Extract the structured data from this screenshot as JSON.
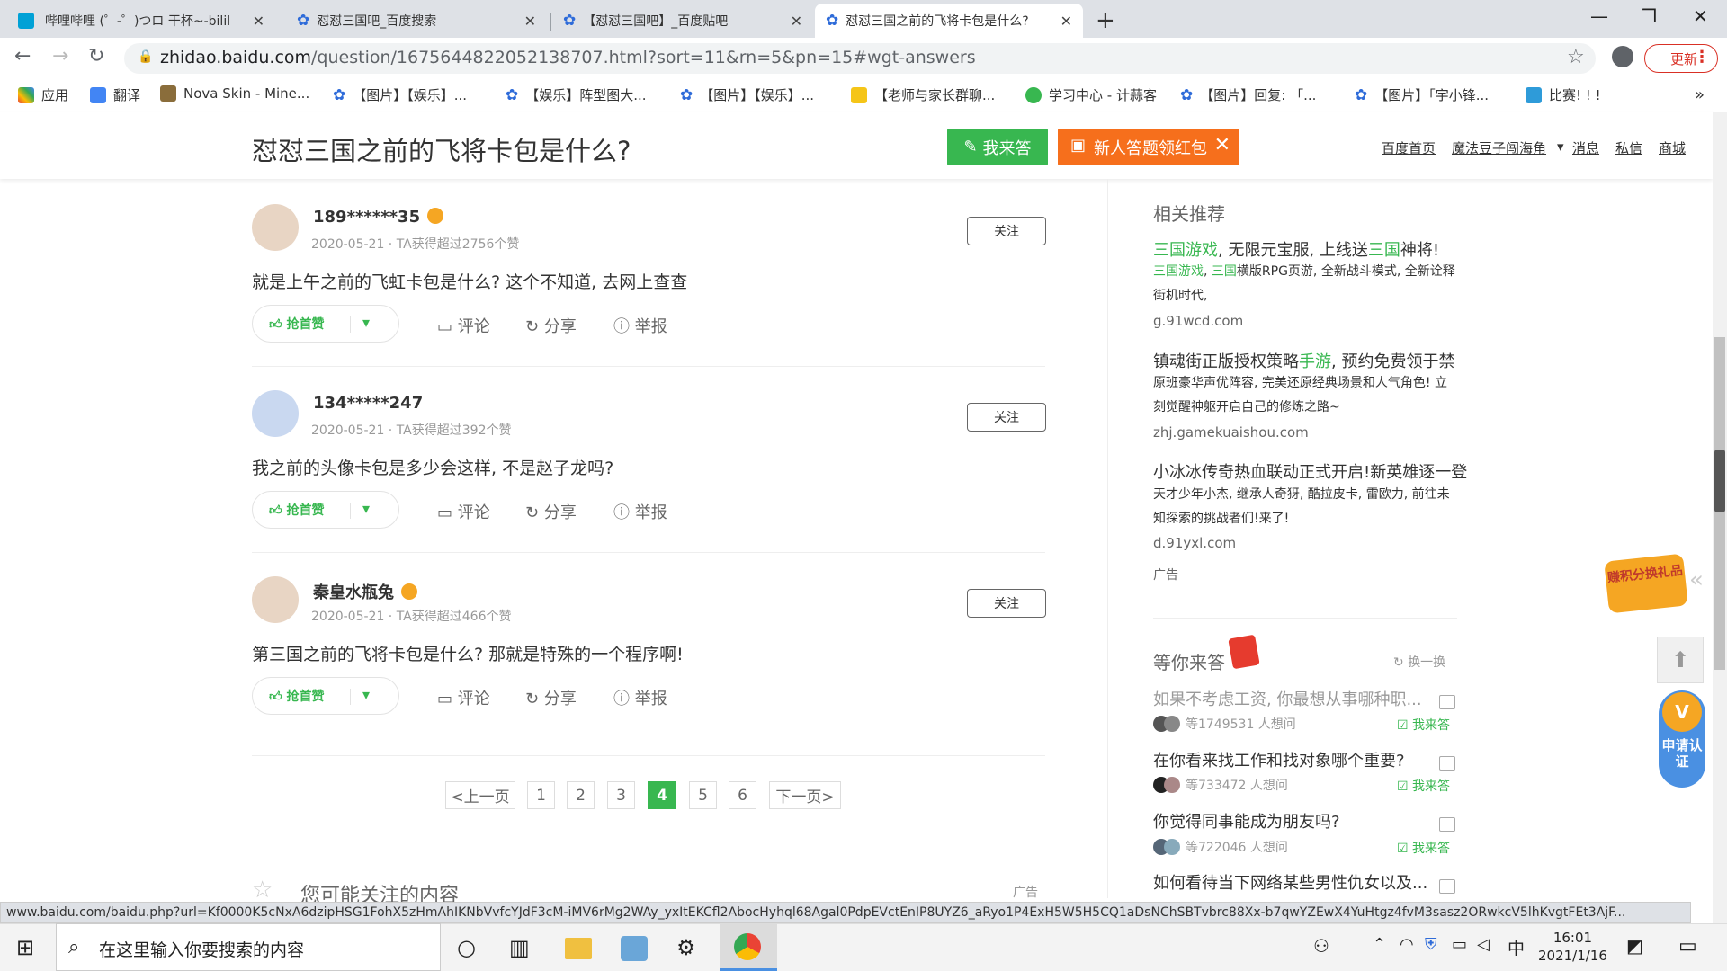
{
  "tabs": [
    {
      "title": "哔哩哔哩 (゜-゜)つロ 干杯~-bilil",
      "active": false
    },
    {
      "title": "怼怼三国吧_百度搜索",
      "active": false
    },
    {
      "title": "【怼怼三国吧】_百度贴吧",
      "active": false
    },
    {
      "title": "怼怼三国之前的飞将卡包是什么?",
      "active": true
    }
  ],
  "url": {
    "host": "zhidao.baidu.com",
    "path": "/question/1675644822052138707.html?sort=11&rn=5&pn=15#wgt-answers"
  },
  "update_label": "更新",
  "bookmarks": [
    "应用",
    "翻译",
    "Nova Skin - Mine...",
    "【图片】【娱乐】...",
    "【娱乐】阵型图大...",
    "【图片】【娱乐】...",
    "【老师与家长群聊...",
    "学习中心 - 计蒜客",
    "【图片】回复: 「...",
    "【图片】「宇小锋...",
    "比赛! ! !"
  ],
  "header": {
    "title": "怼怼三国之前的飞将卡包是什么?",
    "answer_btn": "我来答",
    "hongbao": "新人答题领红包",
    "nav": [
      "百度首页",
      "魔法豆子闯海角",
      "消息",
      "私信",
      "商城"
    ]
  },
  "answers": [
    {
      "user": "189******35",
      "meta": "2020-05-21 · TA获得超过2756个赞",
      "follow": "关注",
      "body": "就是上午之前的飞虹卡包是什么? 这个不知道, 去网上查查"
    },
    {
      "user": "134*****247",
      "meta": "2020-05-21 · TA获得超过392个赞",
      "follow": "关注",
      "body": "我之前的头像卡包是多少会这样, 不是赵子龙吗?"
    },
    {
      "user": "秦皇水瓶兔",
      "meta": "2020-05-21 · TA获得超过466个赞",
      "follow": "关注",
      "body": "第三国之前的飞将卡包是什么? 那就是特殊的一个程序啊!"
    }
  ],
  "actions": {
    "like": "抢首赞",
    "comment": "评论",
    "share": "分享",
    "report": "举报"
  },
  "pagination": {
    "prev": "<上一页",
    "pages": [
      "1",
      "2",
      "3",
      "4",
      "5",
      "6"
    ],
    "current": "4",
    "next": "下一页>"
  },
  "maybe_interested": "您可能关注的内容",
  "ad_label": "广告",
  "sidebar": {
    "related_title": "相关推荐",
    "ads": [
      {
        "head_g1": "三国游戏",
        "head_t1": ", 无限元宝服, 上线送",
        "head_g2": "三国",
        "head_t2": "神将!",
        "desc_g1": "三国游戏",
        "desc_t1": ", ",
        "desc_g2": "三国",
        "desc_t2": "横版RPG页游, 全新战斗模式, 全新诠释街机时代,",
        "url": "g.91wcd.com"
      },
      {
        "head_t1": "镇魂街正版授权策略",
        "head_g1": "手游",
        "head_t2": ", 预约免费领于禁",
        "desc": "原班豪华声优阵容, 完美还原经典场景和人气角色! 立刻觉醒神躯开启自己的修炼之路~",
        "url": "zhj.gamekuaishou.com"
      },
      {
        "head_t1": "小冰冰传奇热血联动正式开启!新英雄逐一登",
        "desc": "天才少年小杰, 继承人奇犽, 酷拉皮卡, 雷欧力, 前往未知探索的挑战者们!来了!",
        "url": "d.91yxl.com"
      }
    ],
    "ad_label": "广告",
    "waiting_title": "等你来答",
    "refresh": "换一换",
    "questions": [
      {
        "q": "如果不考虑工资, 你最想从事哪种职...",
        "count": "等1749531 人想问",
        "ans": "我来答"
      },
      {
        "q": "在你看来找工作和找对象哪个重要?",
        "count": "等733472 人想问",
        "ans": "我来答"
      },
      {
        "q": "你觉得同事能成为朋友吗?",
        "count": "等722046 人想问",
        "ans": "我来答"
      },
      {
        "q": "如何看待当下网络某些男性仇女以及...",
        "count": "",
        "ans": ""
      }
    ]
  },
  "floats": {
    "gift": "赚积分换礼品",
    "verify": "申请认证",
    "vmark": "V"
  },
  "status_url": "www.baidu.com/baidu.php?url=Kf0000K5cNxA6dzipHSG1FohX5zHmAhIKNbVvfcYJdF3cM-iMV6rMg2WAy_yxItEKCfl2AbocHyhql68Agal0PdpEVctEnIP8UYZ6_aRyo1P4ExH5W5H5CQ1aDsNChSBTvbrc88Xx-b7qwYZEwX4YuHtgz4fvM3sasz2ORwkcV5lhKvgtFEt3AjF...",
  "taskbar": {
    "search_placeholder": "在这里输入你要搜索的内容",
    "time": "16:01",
    "date": "2021/1/16",
    "ime": "中"
  }
}
